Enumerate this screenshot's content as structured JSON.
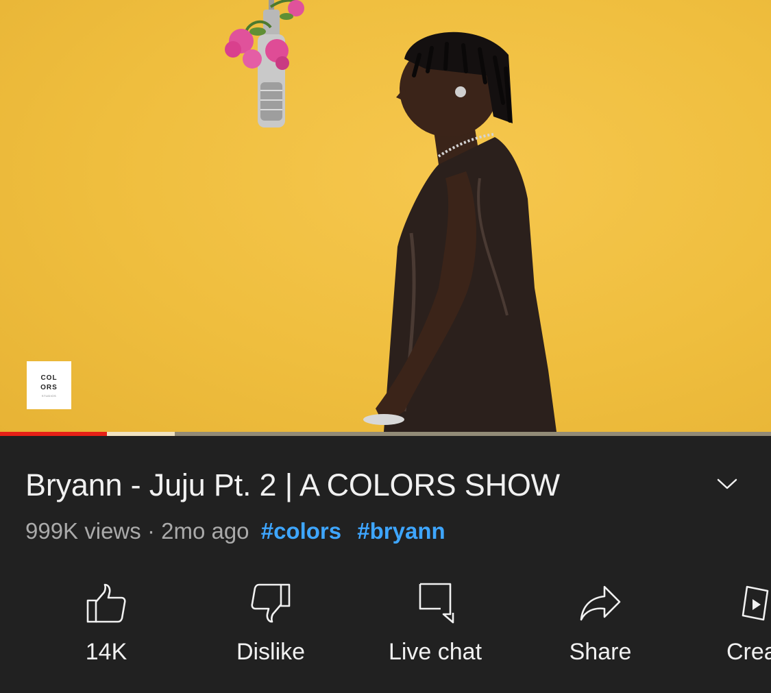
{
  "video": {
    "channel_watermark": {
      "line1": "COL",
      "line2": "ORS",
      "line3": "STUDIOS"
    },
    "progress": {
      "played_fraction": 0.139,
      "buffered_fraction": 0.227
    }
  },
  "details": {
    "title": "Bryann - Juju Pt. 2 | A COLORS SHOW",
    "views": "999K views",
    "separator": "·",
    "age": "2mo ago",
    "hashtags": [
      "#colors",
      "#bryann"
    ]
  },
  "actions": {
    "like": {
      "label": "14K",
      "icon": "thumbs-up-icon"
    },
    "dislike": {
      "label": "Dislike",
      "icon": "thumbs-down-icon"
    },
    "live_chat": {
      "label": "Live chat",
      "icon": "chat-bubble-icon"
    },
    "share": {
      "label": "Share",
      "icon": "share-arrow-icon"
    },
    "create": {
      "label": "Crea",
      "icon": "create-icon"
    }
  },
  "colors": {
    "background": "#212121",
    "video_backdrop": "#efbe3e",
    "progress_played": "#e62117",
    "hashtag": "#3ea6ff",
    "muted_text": "#aaaaaa"
  }
}
